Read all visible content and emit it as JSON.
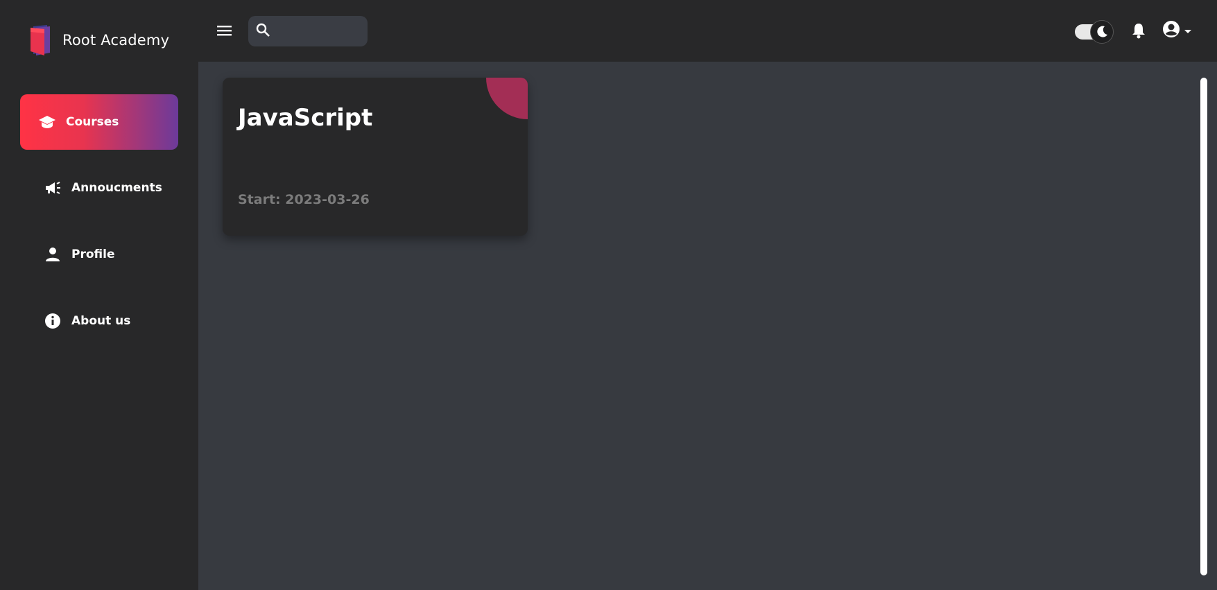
{
  "brand": {
    "name": "Root Academy",
    "logo_icon": "book-logo-icon"
  },
  "sidebar": {
    "items": [
      {
        "label": "Courses",
        "icon": "graduation-cap-icon",
        "active": true
      },
      {
        "label": "Annoucments",
        "icon": "megaphone-icon",
        "active": false
      },
      {
        "label": "Profile",
        "icon": "person-icon",
        "active": false
      },
      {
        "label": "About us",
        "icon": "info-icon",
        "active": false
      }
    ]
  },
  "header": {
    "menu_icon": "hamburger-icon",
    "search": {
      "placeholder": "",
      "value": "",
      "icon": "search-icon"
    },
    "theme_toggle": {
      "mode": "dark",
      "icon": "moon-icon"
    },
    "notifications_icon": "bell-icon",
    "account_icon": "account-circle-icon"
  },
  "courses": [
    {
      "title": "JavaScript",
      "start": "Start: 2023-03-26"
    }
  ],
  "colors": {
    "sidebar_bg": "#282829",
    "main_bg": "#373a40",
    "accent_start": "#ff3345",
    "accent_end": "#6c3a9a",
    "card_corner": "#a32e55"
  }
}
